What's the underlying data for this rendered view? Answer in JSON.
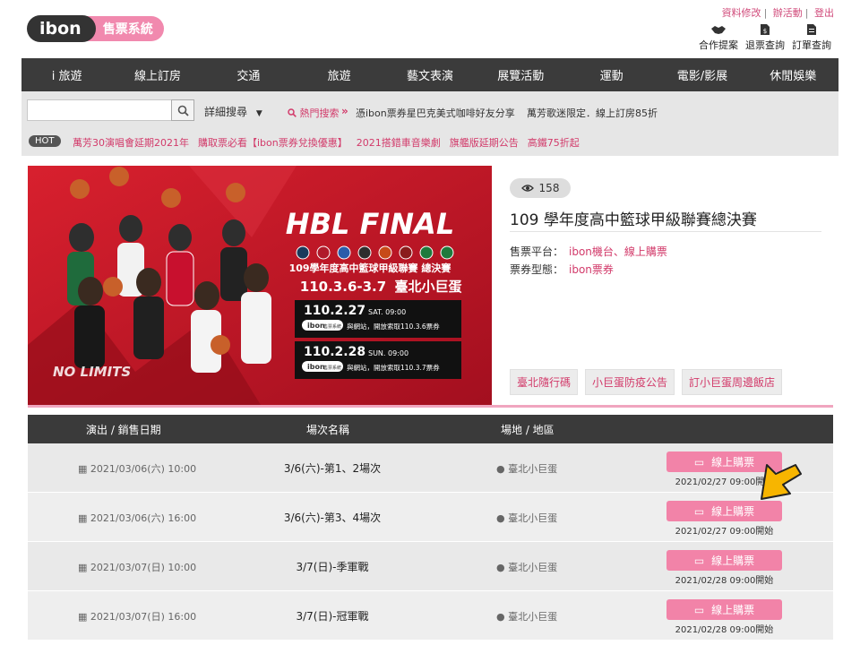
{
  "header": {
    "logo_ibon": "ibon",
    "logo_system": "售票系統",
    "top_links": [
      "資料修改",
      "辦活動",
      "登出"
    ],
    "tools": [
      {
        "icon": "handshake-icon",
        "label": "合作提案"
      },
      {
        "icon": "ticket-icon",
        "label": "退票查詢"
      },
      {
        "icon": "document-icon",
        "label": "訂單查詢"
      }
    ]
  },
  "nav": [
    "i 旅遊",
    "線上訂房",
    "交通",
    "旅遊",
    "藝文表演",
    "展覽活動",
    "運動",
    "電影/影展",
    "休閒娛樂"
  ],
  "search": {
    "placeholder": "",
    "advanced_label": "詳細搜尋",
    "hot_search_label": "熱門搜索",
    "hot_search_items": [
      "憑ibon票券星巴克美式咖啡好友分享",
      "萬芳歌迷限定．線上訂房85折"
    ],
    "hot_badge": "HOT",
    "hot_links": [
      "萬芳30演唱會延期2021年",
      "購取票必看【ibon票券兌換優惠】",
      "2021搭錯車音樂劇",
      "旗艦版延期公告",
      "高鐵75折起"
    ]
  },
  "banner": {
    "title": "HBL FINAL",
    "subtitle": "109學年度高中籃球甲級聯賽 總決賽",
    "dates": "110.3.6-3.7",
    "venue": "臺北小巨蛋",
    "sale1_date": "110.2.27",
    "sale1_time": "SAT. 09:00",
    "sale1_text": "與網站，開放索取110.3.6票券",
    "sale2_date": "110.2.28",
    "sale2_time": "SUN. 09:00",
    "sale2_text": "與網站，開放索取110.3.7票券",
    "ibon_mark": "ibon",
    "ibon_mark_sub": "售票系統",
    "slogan": "NO LIMITS"
  },
  "event": {
    "views": "158",
    "title": "109 學年度高中籃球甲級聯賽總決賽",
    "platform_label": "售票平台：",
    "platform_value": "ibon機台、線上購票",
    "type_label": "票券型態：",
    "type_value": "ibon票券",
    "tags": [
      "臺北隨行碼",
      "小巨蛋防疫公告",
      "訂小巨蛋周邊飯店"
    ]
  },
  "table": {
    "headers": [
      "演出 / 銷售日期",
      "場次名稱",
      "場地 / 地區"
    ],
    "buy_label": "線上購票",
    "rows": [
      {
        "date": "2021/03/06(六) 10:00",
        "name": "3/6(六)-第1、2場次",
        "venue": "臺北小巨蛋",
        "open": "2021/02/27  09:00開始"
      },
      {
        "date": "2021/03/06(六) 16:00",
        "name": "3/6(六)-第3、4場次",
        "venue": "臺北小巨蛋",
        "open": "2021/02/27  09:00開始"
      },
      {
        "date": "2021/03/07(日) 10:00",
        "name": "3/7(日)-季軍戰",
        "venue": "臺北小巨蛋",
        "open": "2021/02/28  09:00開始"
      },
      {
        "date": "2021/03/07(日) 16:00",
        "name": "3/7(日)-冠軍戰",
        "venue": "臺北小巨蛋",
        "open": "2021/02/28  09:00開始"
      }
    ]
  },
  "colors": {
    "accent": "#d23a6a",
    "button": "#f283a8",
    "dark": "#3b3b3b"
  }
}
